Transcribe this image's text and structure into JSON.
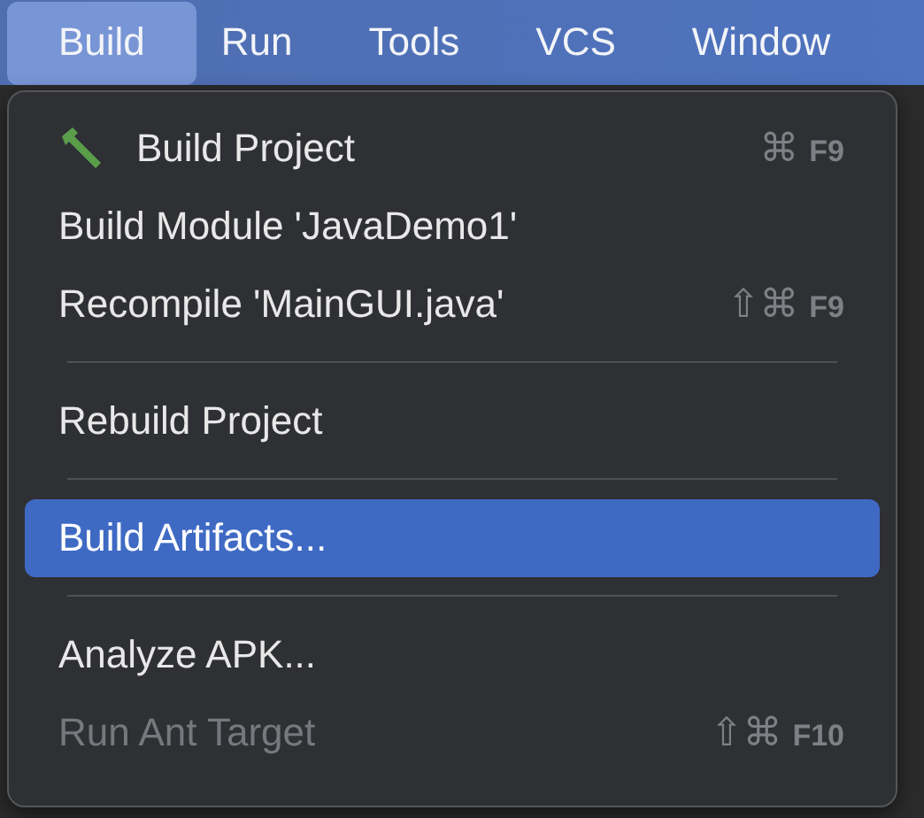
{
  "menubar": [
    {
      "label": "Build",
      "selected": true
    },
    {
      "label": "Run",
      "selected": false
    },
    {
      "label": "Tools",
      "selected": false
    },
    {
      "label": "VCS",
      "selected": false
    },
    {
      "label": "Window",
      "selected": false
    }
  ],
  "menu": [
    {
      "kind": "item",
      "label": "Build Project",
      "has_icon": true,
      "modifiers": "⌘",
      "key": "F9",
      "selected": false,
      "disabled": false
    },
    {
      "kind": "item",
      "label": "Build Module 'JavaDemo1'",
      "selected": false,
      "disabled": false
    },
    {
      "kind": "item",
      "label": "Recompile 'MainGUI.java'",
      "modifiers": "⇧⌘",
      "key": "F9",
      "selected": false,
      "disabled": false
    },
    {
      "kind": "separator"
    },
    {
      "kind": "item",
      "label": "Rebuild Project",
      "selected": false,
      "disabled": false
    },
    {
      "kind": "separator"
    },
    {
      "kind": "item",
      "label": "Build Artifacts...",
      "selected": true,
      "disabled": false
    },
    {
      "kind": "separator"
    },
    {
      "kind": "item",
      "label": "Analyze APK...",
      "selected": false,
      "disabled": false
    },
    {
      "kind": "item",
      "label": "Run Ant Target",
      "modifiers": "⇧⌘",
      "key": "F10",
      "selected": false,
      "disabled": true
    }
  ]
}
